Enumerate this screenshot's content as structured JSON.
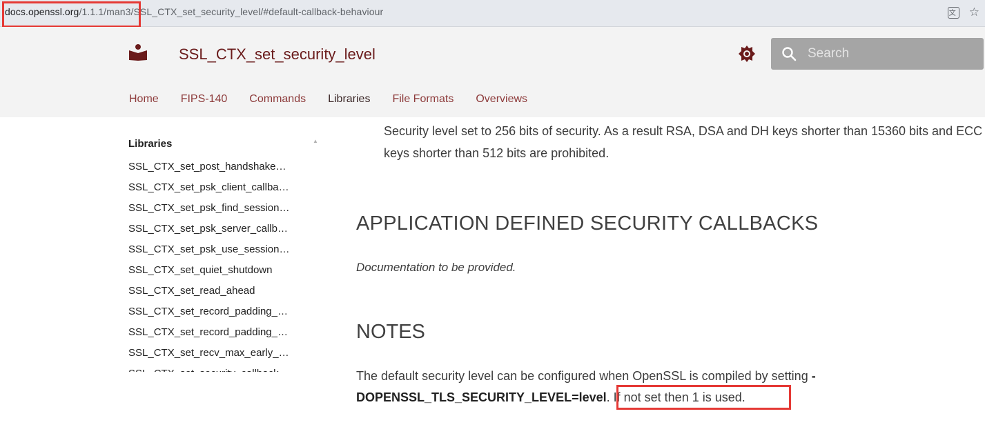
{
  "browser": {
    "url_host": "docs.openssl.org",
    "url_rest": "/1.1.1/man3/SSL_CTX_set_security_level/#default-callback-behaviour",
    "icons": [
      "translate-icon",
      "star-icon"
    ]
  },
  "header": {
    "title": "SSL_CTX_set_security_level",
    "search_placeholder": "Search",
    "brand_color": "#6a1b1b",
    "tabs": [
      {
        "label": "Home"
      },
      {
        "label": "FIPS-140"
      },
      {
        "label": "Commands"
      },
      {
        "label": "Libraries",
        "active": true
      },
      {
        "label": "File Formats"
      },
      {
        "label": "Overviews"
      }
    ]
  },
  "sidebar": {
    "title": "Libraries",
    "items": [
      "SSL_CTX_set_post_handshake…",
      "SSL_CTX_set_psk_client_callba…",
      "SSL_CTX_set_psk_find_session…",
      "SSL_CTX_set_psk_server_callb…",
      "SSL_CTX_set_psk_use_session…",
      "SSL_CTX_set_quiet_shutdown",
      "SSL_CTX_set_read_ahead",
      "SSL_CTX_set_record_padding_…",
      "SSL_CTX_set_record_padding_…",
      "SSL_CTX_set_recv_max_early_…",
      "SSL_CTX_set_security_callback"
    ]
  },
  "content": {
    "level5_text": "Security level set to 256 bits of security. As a result RSA, DSA and DH keys shorter than 15360 bits and ECC keys shorter than 512 bits are prohibited.",
    "app_heading": "APPLICATION DEFINED SECURITY CALLBACKS",
    "app_text": "Documentation to be provided.",
    "notes_heading": "NOTES",
    "notes_text_1": "The default security level can be configured when OpenSSL is compiled by setting ",
    "notes_code": "-DOPENSSL_TLS_SECURITY_LEVEL=level",
    "notes_text_2": ". If not set then 1 is used."
  },
  "highlight_color": "#e53935"
}
